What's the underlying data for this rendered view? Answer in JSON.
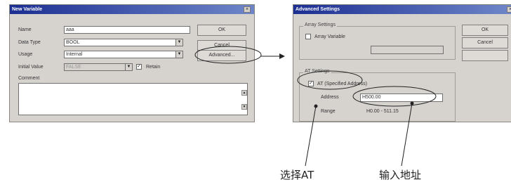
{
  "new_variable": {
    "title": "New Variable",
    "close_glyph": "×",
    "name_label": "Name",
    "name_value": "aaa",
    "data_type_label": "Data Type",
    "data_type_value": "BOOL",
    "usage_label": "Usage",
    "usage_value": "Internal",
    "initial_value_label": "Initial Value",
    "initial_value_value": "FALSE",
    "retain_checked": true,
    "retain_label": "Retain",
    "comment_label": "Comment",
    "ok_label": "OK",
    "cancel_label": "Cancel",
    "advanced_label": "Advanced..."
  },
  "advanced_settings": {
    "title": "Advanced Settings",
    "close_glyph": "×",
    "array_group_title": "Array Settings",
    "array_variable_checked": false,
    "array_variable_label": "Array Variable",
    "array_size_value": "",
    "at_group_title": "AT Settings",
    "at_specified_checked": true,
    "at_specified_label": "AT (Specified Address)",
    "address_label": "Address",
    "address_value": "H500.00",
    "range_label": "Range",
    "range_value": "H0.00 - 511.15",
    "ok_label": "OK",
    "cancel_label": "Cancel"
  },
  "annotations": {
    "select_at": "选择AT",
    "enter_address": "输入地址"
  },
  "icons": {
    "dropdown": "dropdown-arrow-icon",
    "check": "checkmark-icon",
    "close": "close-icon",
    "scroll_up": "scroll-up-icon",
    "scroll_down": "scroll-down-icon"
  },
  "colors": {
    "dialog_bg": "#d6d3cf",
    "titlebar_start": "#1c2f92",
    "titlebar_end": "#6e86c8",
    "callout_stroke": "#222222"
  }
}
